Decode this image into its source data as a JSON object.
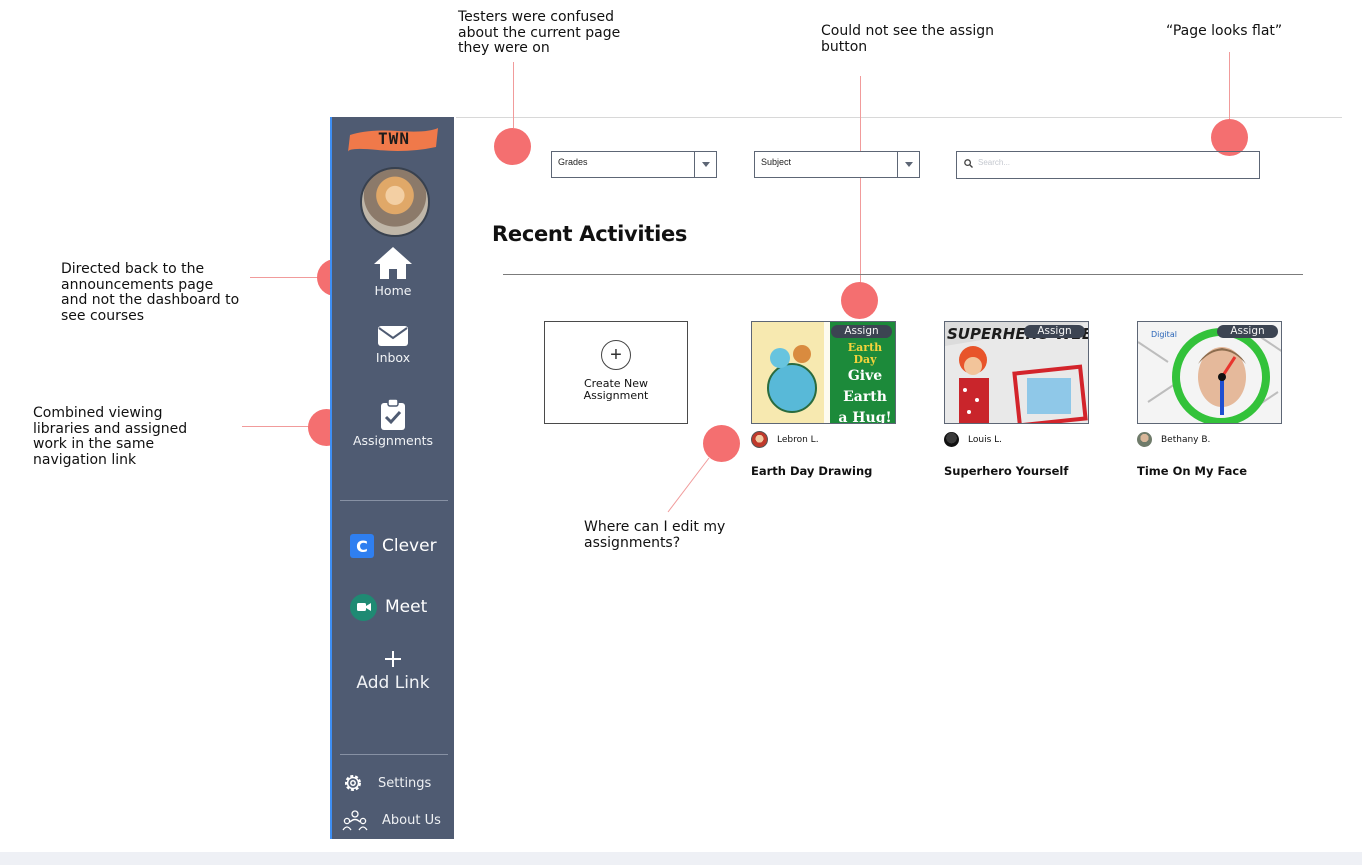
{
  "annotations": {
    "current_page": [
      "Testers were confused",
      "about the current page",
      "they were on"
    ],
    "assign_button": [
      "Could not see the assign",
      "button"
    ],
    "page_flat": "“Page looks flat”",
    "home": [
      "Directed back to the",
      "announcements page",
      "and not the dashboard to",
      "see courses"
    ],
    "assignments": [
      "Combined viewing",
      "libraries and assigned",
      "work in the same",
      "navigation link"
    ],
    "edit": [
      "Where can I edit my",
      "assignments?"
    ],
    "dot_color": "#f46f70"
  },
  "sidebar": {
    "logo": "TWN",
    "logo_color": "#f0794a",
    "background": "#4f5b72",
    "nav": [
      {
        "label": "Home",
        "icon": "home-icon"
      },
      {
        "label": "Inbox",
        "icon": "envelope-icon"
      },
      {
        "label": "Assignments",
        "icon": "clipboard-check-icon"
      }
    ],
    "externals": [
      {
        "label": "Clever",
        "icon": "clever-icon",
        "badge": "C"
      },
      {
        "label": "Meet",
        "icon": "meet-icon"
      }
    ],
    "add_link": {
      "label": "Add Link",
      "icon": "plus-icon"
    },
    "bottom": [
      {
        "label": "Settings",
        "icon": "gear-icon"
      },
      {
        "label": "About Us",
        "icon": "people-icon"
      }
    ]
  },
  "filters": {
    "grades": "Grades",
    "subject": "Subject",
    "search_placeholder": "Search..."
  },
  "main": {
    "heading": "Recent Activities",
    "create_label": [
      "Create New",
      "Assignment"
    ],
    "assign_label": "Assign",
    "cards": [
      {
        "title": "Earth Day Drawing",
        "author": "Lebron L.",
        "thumb_text": [
          "Earth Day",
          "Give",
          "Earth",
          "a Hug!"
        ]
      },
      {
        "title": "Superhero Yourself",
        "author": "Louis L.",
        "thumb_text": [
          "SUPERHERO WEE"
        ]
      },
      {
        "title": "Time On My Face",
        "author": "Bethany B.",
        "thumb_text": [
          "Digital"
        ]
      }
    ]
  }
}
